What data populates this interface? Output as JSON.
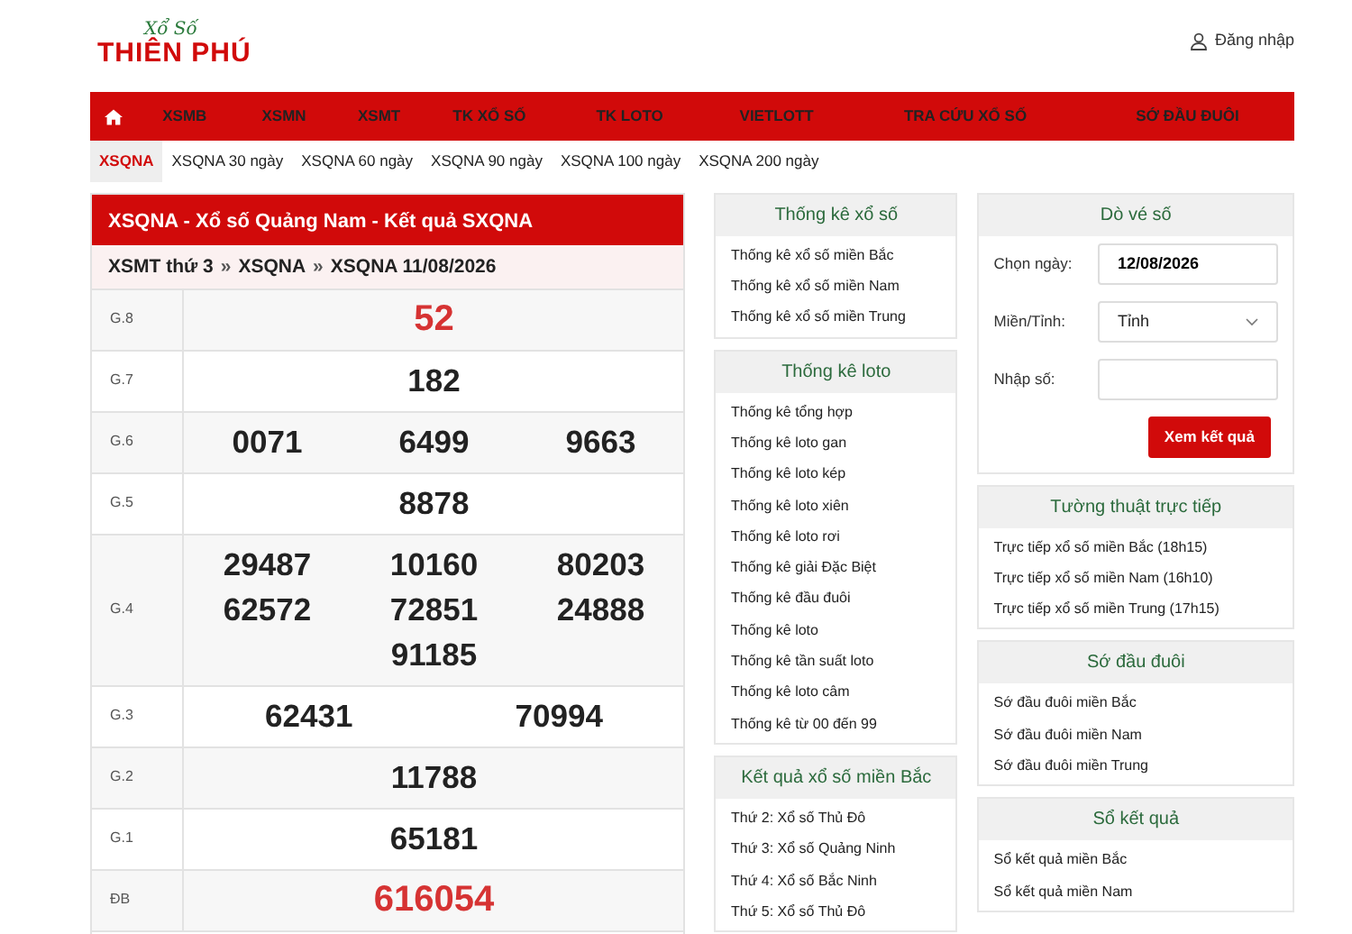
{
  "logo": {
    "script": "Xổ Số",
    "name": "THIÊN PHÚ"
  },
  "login": "Đăng nhập",
  "nav": [
    "XSMB",
    "XSMN",
    "XSMT",
    "TK XỔ SỐ",
    "TK LOTO",
    "VIETLOTT",
    "TRA CỨU XỔ SỐ",
    "SỚ ĐẦU ĐUÔI"
  ],
  "subnav": [
    {
      "label": "XSQNA",
      "selected": true
    },
    {
      "label": "XSQNA 30 ngày",
      "selected": false
    },
    {
      "label": "XSQNA 60 ngày",
      "selected": false
    },
    {
      "label": "XSQNA 90 ngày",
      "selected": false
    },
    {
      "label": "XSQNA 100 ngày",
      "selected": false
    },
    {
      "label": "XSQNA 200 ngày",
      "selected": false
    }
  ],
  "results": {
    "title": "XSQNA - Xổ số Quảng Nam - Kết quả SXQNA",
    "breadcrumb": [
      "XSMT thứ 3",
      "XSQNA",
      "XSQNA 11/08/2026"
    ],
    "separator": "»",
    "prizes": [
      {
        "label": "G.8",
        "highlight": true,
        "numbers": [
          "52"
        ]
      },
      {
        "label": "G.7",
        "highlight": false,
        "numbers": [
          "182"
        ]
      },
      {
        "label": "G.6",
        "highlight": false,
        "numbers": [
          "0071",
          "6499",
          "9663"
        ]
      },
      {
        "label": "G.5",
        "highlight": false,
        "numbers": [
          "8878"
        ]
      },
      {
        "label": "G.4",
        "highlight": false,
        "numbers": [
          "29487",
          "10160",
          "80203",
          "62572",
          "72851",
          "24888",
          "91185"
        ]
      },
      {
        "label": "G.3",
        "highlight": false,
        "numbers": [
          "62431",
          "70994"
        ]
      },
      {
        "label": "G.2",
        "highlight": false,
        "numbers": [
          "11788"
        ]
      },
      {
        "label": "G.1",
        "highlight": false,
        "numbers": [
          "65181"
        ]
      },
      {
        "label": "ĐB",
        "highlight": true,
        "numbers": [
          "616054"
        ]
      }
    ]
  },
  "middle_boxes": [
    {
      "title": "Thống kê xổ số",
      "items": [
        "Thống kê xổ số miền Bắc",
        "Thống kê xổ số miền Nam",
        "Thống kê xổ số miền Trung"
      ]
    },
    {
      "title": "Thống kê loto",
      "items": [
        "Thống kê tổng hợp",
        "Thống kê loto gan",
        "Thống kê loto kép",
        "Thống kê loto xiên",
        "Thống kê loto rơi",
        "Thống kê giải Đặc Biệt",
        "Thống kê đầu đuôi",
        "Thống kê loto",
        "Thống kê tần suất loto",
        "Thống kê loto câm",
        "Thống kê từ 00 đến 99"
      ]
    },
    {
      "title": "Kết quả xổ số miền Bắc",
      "items": [
        "Thứ 2: Xổ số Thủ Đô",
        "Thứ 3: Xổ số Quảng Ninh",
        "Thứ 4: Xổ số Bắc Ninh",
        "Thứ 5: Xổ số Thủ Đô"
      ]
    }
  ],
  "ticket_check": {
    "title": "Dò vé số",
    "date_label": "Chọn ngày:",
    "date_value": "12/08/2026",
    "province_label": "Miền/Tỉnh:",
    "province_value": "Tỉnh",
    "number_label": "Nhập số:",
    "button": "Xem kết quả"
  },
  "right_boxes": [
    {
      "title": "Tường thuật trực tiếp",
      "items": [
        "Trực tiếp xổ số miền Bắc (18h15)",
        "Trực tiếp xổ số miền Nam (16h10)",
        "Trực tiếp xổ số miền Trung (17h15)"
      ]
    },
    {
      "title": "Sớ đầu đuôi",
      "items": [
        "Sớ đầu đuôi miền Bắc",
        "Sớ đầu đuôi miền Nam",
        "Sớ đầu đuôi miền Trung"
      ]
    },
    {
      "title": "Sổ kết quả",
      "items": [
        "Sổ kết quả miền Bắc",
        "Sổ kết quả miền Nam"
      ]
    }
  ]
}
